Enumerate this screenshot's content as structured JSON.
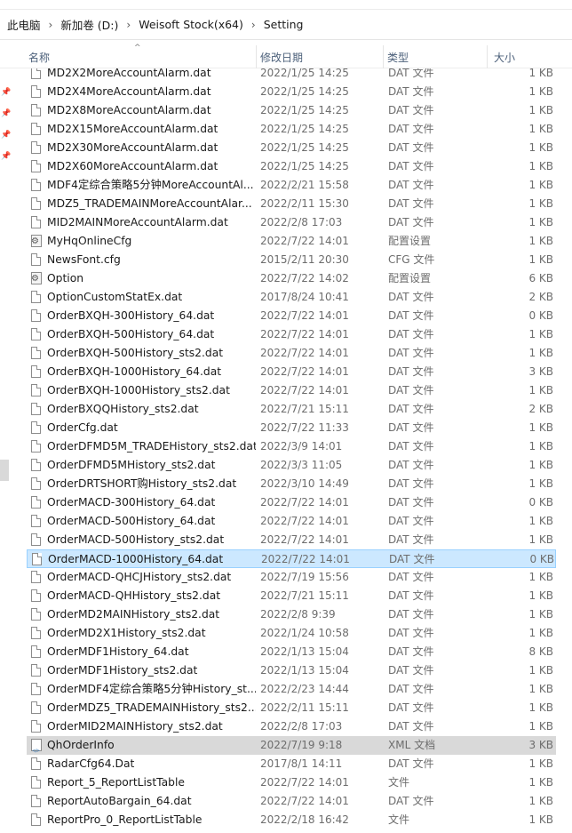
{
  "breadcrumb": {
    "items": [
      "此电脑",
      "新加卷 (D:)",
      "Weisoft Stock(x64)",
      "Setting"
    ],
    "separator": "›"
  },
  "columns": {
    "name": "名称",
    "date": "修改日期",
    "type": "类型",
    "size": "大小",
    "sort_indicator": "^"
  },
  "files": [
    {
      "name": "MD2X2MoreAccountAlarm.dat",
      "date": "2022/1/25 14:25",
      "type": "DAT 文件",
      "size": "1 KB",
      "icon": "file-icon"
    },
    {
      "name": "MD2X4MoreAccountAlarm.dat",
      "date": "2022/1/25 14:25",
      "type": "DAT 文件",
      "size": "1 KB",
      "icon": "file-icon"
    },
    {
      "name": "MD2X8MoreAccountAlarm.dat",
      "date": "2022/1/25 14:25",
      "type": "DAT 文件",
      "size": "1 KB",
      "icon": "file-icon"
    },
    {
      "name": "MD2X15MoreAccountAlarm.dat",
      "date": "2022/1/25 14:25",
      "type": "DAT 文件",
      "size": "1 KB",
      "icon": "file-icon"
    },
    {
      "name": "MD2X30MoreAccountAlarm.dat",
      "date": "2022/1/25 14:25",
      "type": "DAT 文件",
      "size": "1 KB",
      "icon": "file-icon"
    },
    {
      "name": "MD2X60MoreAccountAlarm.dat",
      "date": "2022/1/25 14:25",
      "type": "DAT 文件",
      "size": "1 KB",
      "icon": "file-icon"
    },
    {
      "name": "MDF4定综合策略5分钟MoreAccountAl...",
      "date": "2022/2/21 15:58",
      "type": "DAT 文件",
      "size": "1 KB",
      "icon": "file-icon"
    },
    {
      "name": "MDZ5_TRADEMAINMoreAccountAlar...",
      "date": "2022/2/11 15:30",
      "type": "DAT 文件",
      "size": "1 KB",
      "icon": "file-icon"
    },
    {
      "name": "MID2MAINMoreAccountAlarm.dat",
      "date": "2022/2/8 17:03",
      "type": "DAT 文件",
      "size": "1 KB",
      "icon": "file-icon"
    },
    {
      "name": "MyHqOnlineCfg",
      "date": "2022/7/22 14:01",
      "type": "配置设置",
      "size": "1 KB",
      "icon": "config-icon"
    },
    {
      "name": "NewsFont.cfg",
      "date": "2015/2/11 20:30",
      "type": "CFG 文件",
      "size": "1 KB",
      "icon": "file-icon"
    },
    {
      "name": "Option",
      "date": "2022/7/22 14:02",
      "type": "配置设置",
      "size": "6 KB",
      "icon": "config-icon"
    },
    {
      "name": "OptionCustomStatEx.dat",
      "date": "2017/8/24 10:41",
      "type": "DAT 文件",
      "size": "2 KB",
      "icon": "file-icon"
    },
    {
      "name": "OrderBXQH-300History_64.dat",
      "date": "2022/7/22 14:01",
      "type": "DAT 文件",
      "size": "0 KB",
      "icon": "file-icon"
    },
    {
      "name": "OrderBXQH-500History_64.dat",
      "date": "2022/7/22 14:01",
      "type": "DAT 文件",
      "size": "1 KB",
      "icon": "file-icon"
    },
    {
      "name": "OrderBXQH-500History_sts2.dat",
      "date": "2022/7/22 14:01",
      "type": "DAT 文件",
      "size": "1 KB",
      "icon": "file-icon"
    },
    {
      "name": "OrderBXQH-1000History_64.dat",
      "date": "2022/7/22 14:01",
      "type": "DAT 文件",
      "size": "3 KB",
      "icon": "file-icon"
    },
    {
      "name": "OrderBXQH-1000History_sts2.dat",
      "date": "2022/7/22 14:01",
      "type": "DAT 文件",
      "size": "1 KB",
      "icon": "file-icon"
    },
    {
      "name": "OrderBXQQHistory_sts2.dat",
      "date": "2022/7/21 15:11",
      "type": "DAT 文件",
      "size": "2 KB",
      "icon": "file-icon"
    },
    {
      "name": "OrderCfg.dat",
      "date": "2022/7/22 11:33",
      "type": "DAT 文件",
      "size": "1 KB",
      "icon": "file-icon"
    },
    {
      "name": "OrderDFMD5M_TRADEHistory_sts2.dat",
      "date": "2022/3/9 14:01",
      "type": "DAT 文件",
      "size": "1 KB",
      "icon": "file-icon"
    },
    {
      "name": "OrderDFMD5MHistory_sts2.dat",
      "date": "2022/3/3 11:05",
      "type": "DAT 文件",
      "size": "1 KB",
      "icon": "file-icon"
    },
    {
      "name": "OrderDRTSHORT购History_sts2.dat",
      "date": "2022/3/10 14:49",
      "type": "DAT 文件",
      "size": "1 KB",
      "icon": "file-icon"
    },
    {
      "name": "OrderMACD-300History_64.dat",
      "date": "2022/7/22 14:01",
      "type": "DAT 文件",
      "size": "0 KB",
      "icon": "file-icon"
    },
    {
      "name": "OrderMACD-500History_64.dat",
      "date": "2022/7/22 14:01",
      "type": "DAT 文件",
      "size": "1 KB",
      "icon": "file-icon"
    },
    {
      "name": "OrderMACD-500History_sts2.dat",
      "date": "2022/7/22 14:01",
      "type": "DAT 文件",
      "size": "1 KB",
      "icon": "file-icon"
    },
    {
      "name": "OrderMACD-1000History_64.dat",
      "date": "2022/7/22 14:01",
      "type": "DAT 文件",
      "size": "0 KB",
      "icon": "file-icon",
      "state": "hover"
    },
    {
      "name": "OrderMACD-QHCJHistory_sts2.dat",
      "date": "2022/7/19 15:56",
      "type": "DAT 文件",
      "size": "1 KB",
      "icon": "file-icon"
    },
    {
      "name": "OrderMACD-QHHistory_sts2.dat",
      "date": "2022/7/21 15:11",
      "type": "DAT 文件",
      "size": "1 KB",
      "icon": "file-icon"
    },
    {
      "name": "OrderMD2MAINHistory_sts2.dat",
      "date": "2022/2/8 9:39",
      "type": "DAT 文件",
      "size": "1 KB",
      "icon": "file-icon"
    },
    {
      "name": "OrderMD2X1History_sts2.dat",
      "date": "2022/1/24 10:58",
      "type": "DAT 文件",
      "size": "1 KB",
      "icon": "file-icon"
    },
    {
      "name": "OrderMDF1History_64.dat",
      "date": "2022/1/13 15:04",
      "type": "DAT 文件",
      "size": "8 KB",
      "icon": "file-icon"
    },
    {
      "name": "OrderMDF1History_sts2.dat",
      "date": "2022/1/13 15:04",
      "type": "DAT 文件",
      "size": "1 KB",
      "icon": "file-icon"
    },
    {
      "name": "OrderMDF4定综合策略5分钟History_st...",
      "date": "2022/2/23 14:44",
      "type": "DAT 文件",
      "size": "1 KB",
      "icon": "file-icon"
    },
    {
      "name": "OrderMDZ5_TRADEMAINHistory_sts2...",
      "date": "2022/2/11 15:11",
      "type": "DAT 文件",
      "size": "1 KB",
      "icon": "file-icon"
    },
    {
      "name": "OrderMID2MAINHistory_sts2.dat",
      "date": "2022/2/8 17:03",
      "type": "DAT 文件",
      "size": "1 KB",
      "icon": "file-icon"
    },
    {
      "name": "QhOrderInfo",
      "date": "2022/7/19 9:18",
      "type": "XML 文档",
      "size": "3 KB",
      "icon": "xml-icon",
      "state": "selected"
    },
    {
      "name": "RadarCfg64.Dat",
      "date": "2017/8/1 14:11",
      "type": "DAT 文件",
      "size": "1 KB",
      "icon": "file-icon"
    },
    {
      "name": "Report_5_ReportListTable",
      "date": "2022/7/22 14:01",
      "type": "文件",
      "size": "1 KB",
      "icon": "file-icon"
    },
    {
      "name": "ReportAutoBargain_64.dat",
      "date": "2022/7/22 14:01",
      "type": "DAT 文件",
      "size": "1 KB",
      "icon": "file-icon"
    },
    {
      "name": "ReportPro_0_ReportListTable",
      "date": "2022/2/18 16:42",
      "type": "文件",
      "size": "1 KB",
      "icon": "file-icon"
    }
  ]
}
